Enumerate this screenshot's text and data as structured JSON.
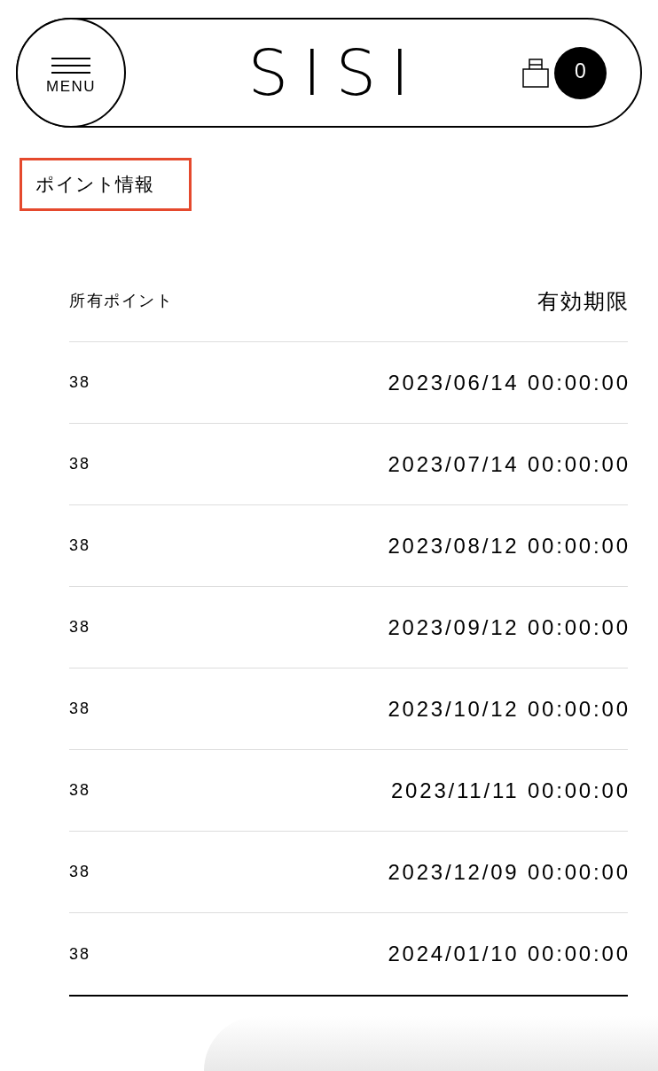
{
  "header": {
    "menu_label": "MENU",
    "logo": "SISI",
    "cart_count": "0"
  },
  "section_title": "ポイント情報",
  "table": {
    "columns": [
      "所有ポイント",
      "有効期限"
    ],
    "rows": [
      {
        "points": "38",
        "expires": "2023/06/14 00:00:00"
      },
      {
        "points": "38",
        "expires": "2023/07/14 00:00:00"
      },
      {
        "points": "38",
        "expires": "2023/08/12 00:00:00"
      },
      {
        "points": "38",
        "expires": "2023/09/12 00:00:00"
      },
      {
        "points": "38",
        "expires": "2023/10/12 00:00:00"
      },
      {
        "points": "38",
        "expires": "2023/11/11 00:00:00"
      },
      {
        "points": "38",
        "expires": "2023/12/09 00:00:00"
      },
      {
        "points": "38",
        "expires": "2024/01/10 00:00:00"
      }
    ]
  }
}
